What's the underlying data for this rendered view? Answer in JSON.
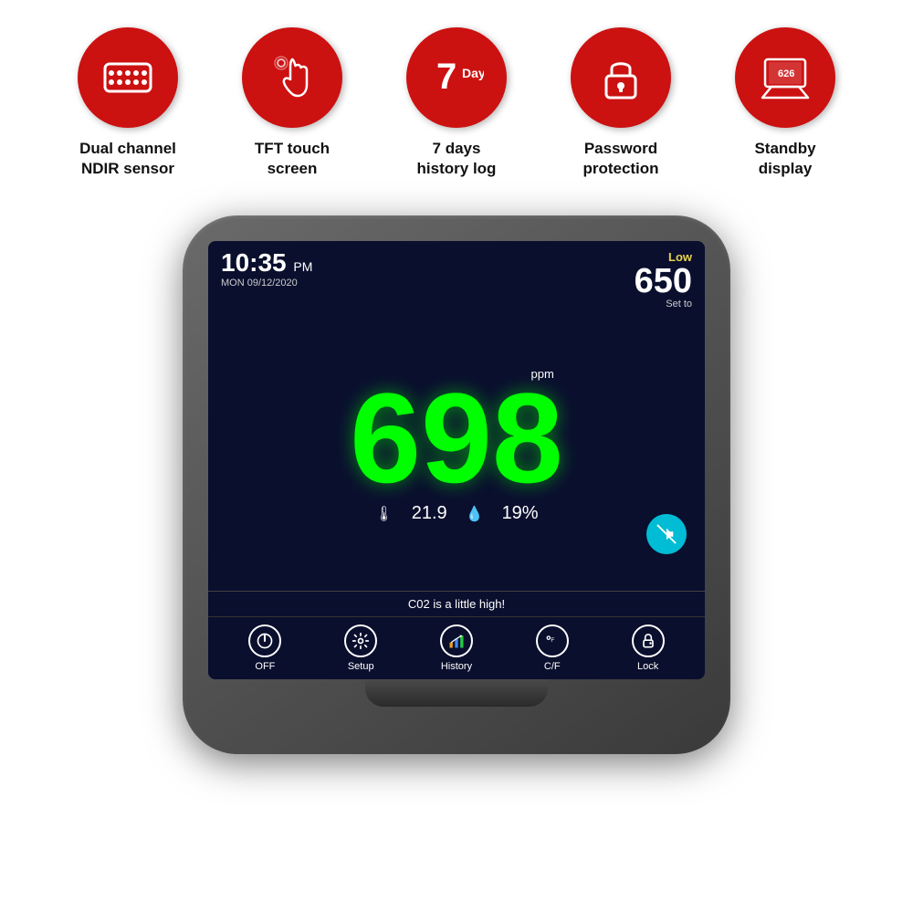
{
  "features": [
    {
      "id": "dual-channel",
      "label": "Dual channel\nNDIR sensor",
      "icon": "sensor-icon"
    },
    {
      "id": "tft-touch",
      "label": "TFT touch\nscreen",
      "icon": "touch-icon"
    },
    {
      "id": "history-log",
      "label": "7 days\nhistory log",
      "icon": "history-icon"
    },
    {
      "id": "password",
      "label": "Password\nprotection",
      "icon": "lock-icon"
    },
    {
      "id": "standby",
      "label": "Standby\ndisplay",
      "icon": "display-icon"
    }
  ],
  "device": {
    "time": "10:35",
    "ampm": "PM",
    "date": "MON 09/12/2020",
    "co2_value": "698",
    "co2_unit": "ppm",
    "co2_limit": "650",
    "co2_status": "Low",
    "set_to_label": "Set to",
    "temperature": "21.9",
    "humidity": "19%",
    "alert_message": "C02 is a little high!",
    "toolbar": [
      {
        "id": "off",
        "label": "OFF",
        "icon": "power"
      },
      {
        "id": "setup",
        "label": "Setup",
        "icon": "gear"
      },
      {
        "id": "history",
        "label": "History",
        "icon": "chart"
      },
      {
        "id": "cf",
        "label": "C/F",
        "icon": "temp"
      },
      {
        "id": "lock",
        "label": "Lock",
        "icon": "lock"
      }
    ]
  },
  "colors": {
    "red_circle": "#cc1111",
    "screen_bg": "#0a0f2e",
    "co2_green": "#00ff00",
    "accent_cyan": "#00bcd4",
    "low_yellow": "#e8d44d"
  }
}
